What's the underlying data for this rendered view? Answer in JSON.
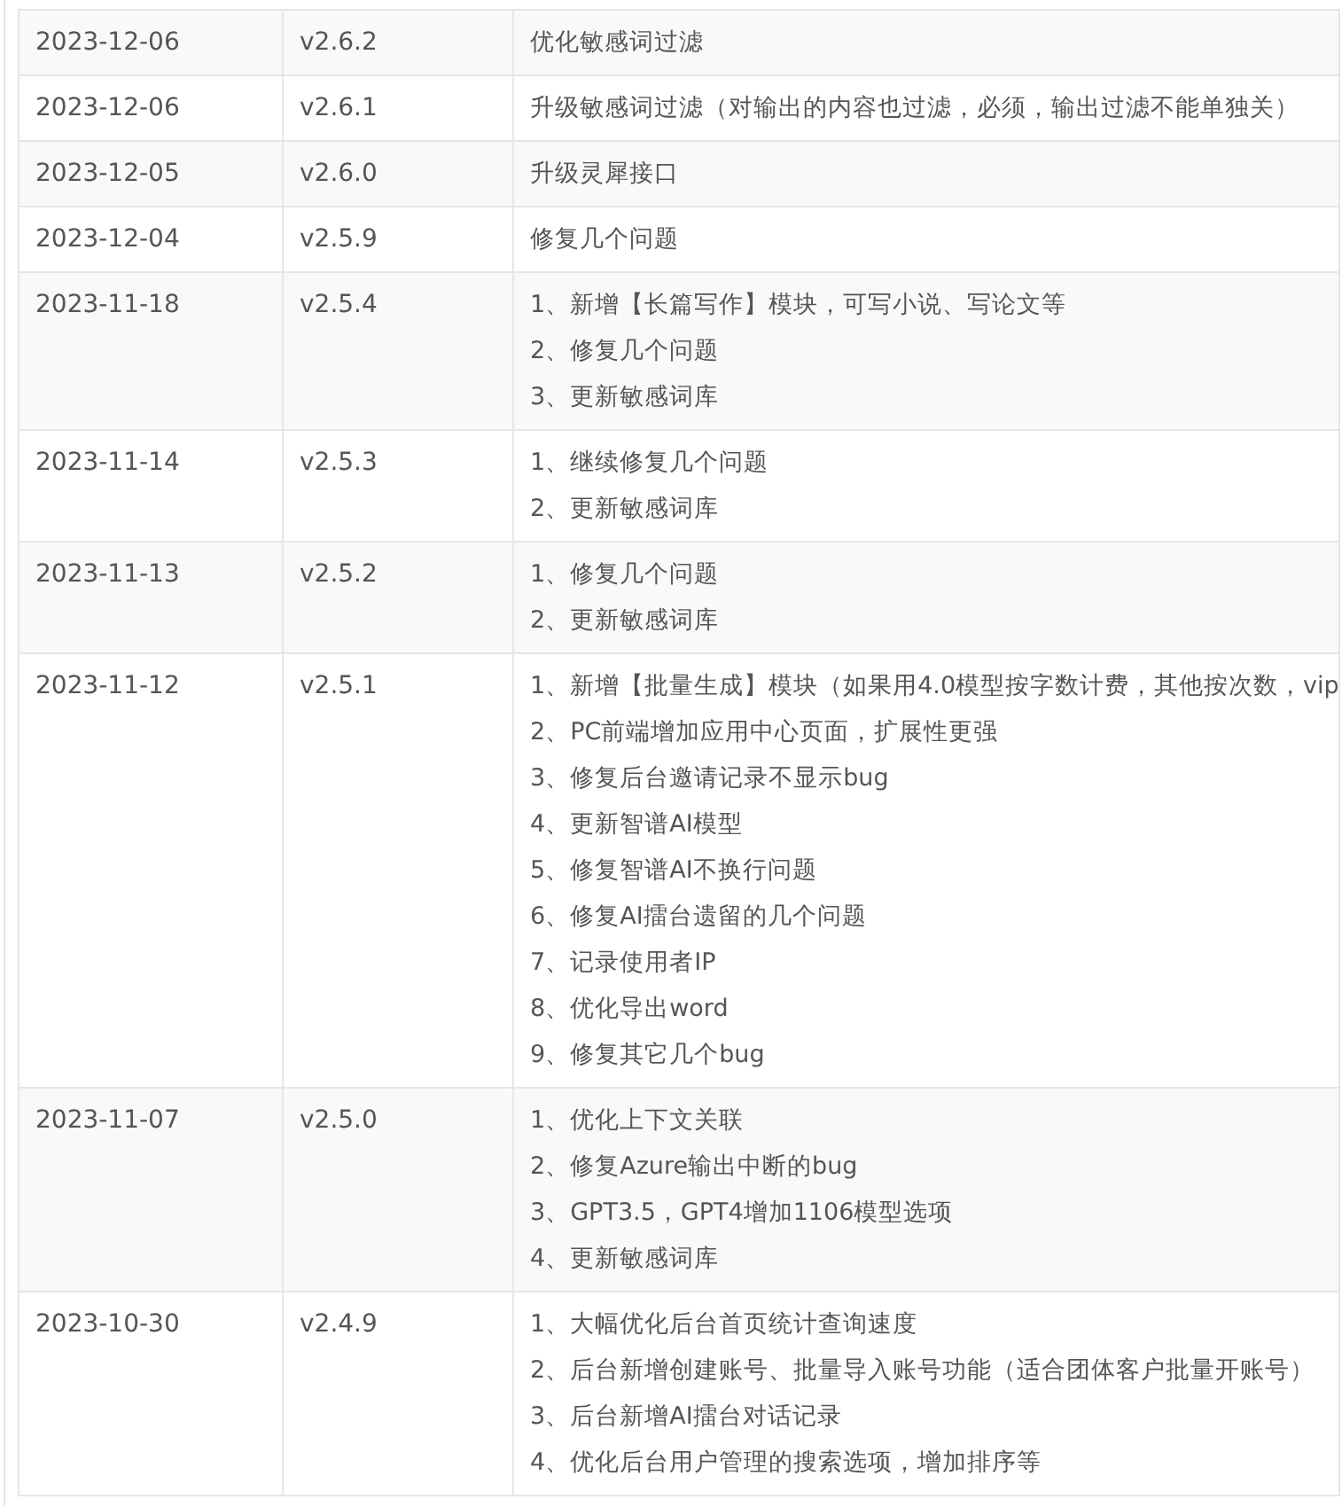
{
  "changelog": {
    "rows": [
      {
        "date": "2023-12-06",
        "version": "v2.6.2",
        "changes": [
          "优化敏感词过滤"
        ]
      },
      {
        "date": "2023-12-06",
        "version": "v2.6.1",
        "changes": [
          "升级敏感词过滤（对输出的内容也过滤，必须，输出过滤不能单独关）"
        ]
      },
      {
        "date": "2023-12-05",
        "version": "v2.6.0",
        "changes": [
          "升级灵犀接口"
        ]
      },
      {
        "date": "2023-12-04",
        "version": "v2.5.9",
        "changes": [
          "修复几个问题"
        ]
      },
      {
        "date": "2023-11-18",
        "version": "v2.5.4",
        "changes": [
          "1、新增【长篇写作】模块，可写小说、写论文等",
          "2、修复几个问题",
          "3、更新敏感词库"
        ]
      },
      {
        "date": "2023-11-14",
        "version": "v2.5.3",
        "changes": [
          "1、继续修复几个问题",
          "2、更新敏感词库"
        ]
      },
      {
        "date": "2023-11-13",
        "version": "v2.5.2",
        "changes": [
          "1、修复几个问题",
          "2、更新敏感词库"
        ]
      },
      {
        "date": "2023-11-12",
        "version": "v2.5.1",
        "changes": [
          "1、新增【批量生成】模块（如果用4.0模型按字数计费，其他按次数，vip",
          "2、PC前端增加应用中心页面，扩展性更强",
          "3、修复后台邀请记录不显示bug",
          "4、更新智谱AI模型",
          "5、修复智谱AI不换行问题",
          "6、修复AI擂台遗留的几个问题",
          "7、记录使用者IP",
          "8、优化导出word",
          "9、修复其它几个bug"
        ]
      },
      {
        "date": "2023-11-07",
        "version": "v2.5.0",
        "changes": [
          "1、优化上下文关联",
          "2、修复Azure输出中断的bug",
          "3、GPT3.5，GPT4增加1106模型选项",
          "4、更新敏感词库"
        ]
      },
      {
        "date": "2023-10-30",
        "version": "v2.4.9",
        "changes": [
          "1、大幅优化后台首页统计查询速度",
          "2、后台新增创建账号、批量导入账号功能（适合团体客户批量开账号）",
          "3、后台新增AI擂台对话记录",
          "4、优化后台用户管理的搜索选项，增加排序等"
        ]
      }
    ]
  }
}
